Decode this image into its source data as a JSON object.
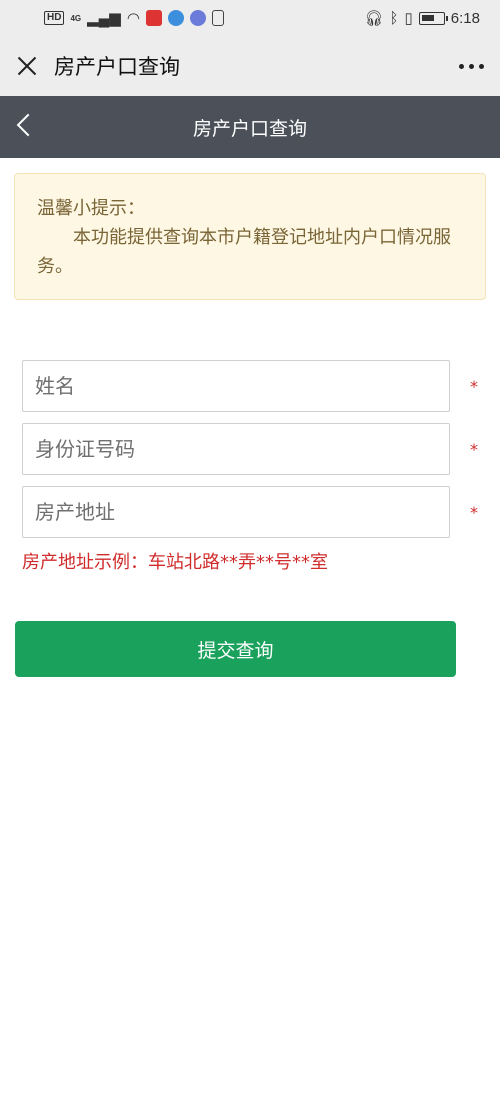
{
  "status_bar": {
    "network": "HD",
    "network_type": "4G",
    "time": "6:18"
  },
  "titlebar": {
    "title": "房产户口查询"
  },
  "page_header": {
    "title": "房产户口查询"
  },
  "notice": {
    "heading": "温馨小提示：",
    "body": "本功能提供查询本市户籍登记地址内户口情况服务。"
  },
  "form": {
    "name_placeholder": "姓名",
    "id_placeholder": "身份证号码",
    "address_placeholder": "房产地址",
    "required_mark": "*",
    "address_hint": "房产地址示例：车站北路**弄**号**室",
    "submit_label": "提交查询"
  },
  "colors": {
    "header_bg": "#4b5059",
    "notice_bg": "#fdf7e3",
    "accent_green": "#1aa25c",
    "error_red": "#d12c2c"
  }
}
